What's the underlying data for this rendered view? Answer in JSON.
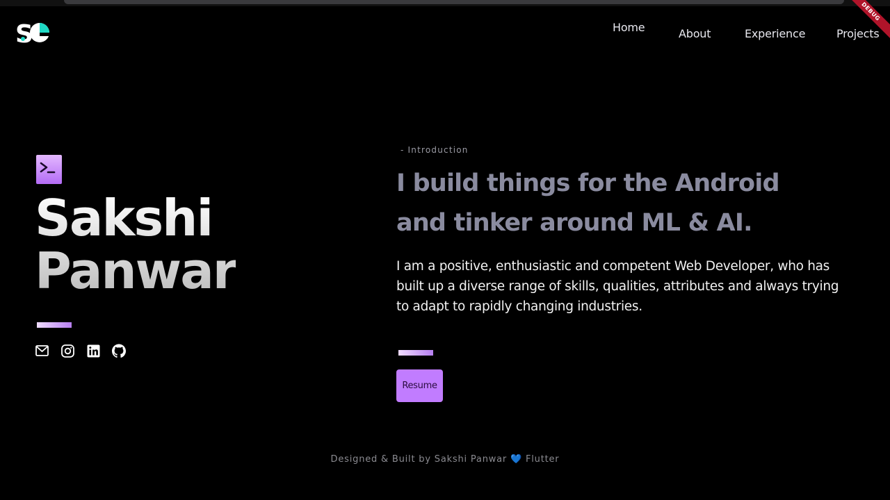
{
  "nav": {
    "home": "Home",
    "about": "About",
    "experience": "Experience",
    "projects": "Projects"
  },
  "debug_banner": "DEBUG",
  "hero": {
    "first_name": "Sakshi",
    "last_name": "Panwar",
    "intro_label": "- Introduction",
    "headline": "I build things for the Android and tinker around ML & AI.",
    "description": "I am a positive, enthusiastic and competent Web Developer, who has built up a diverse range of skills, qualities, attributes and always trying to adapt to rapidly changing industries.",
    "resume_button": "Resume"
  },
  "socials": [
    "mail-icon",
    "instagram-icon",
    "linkedin-icon",
    "github-icon"
  ],
  "footer": {
    "prefix": "Designed & Built by Sakshi Panwar",
    "heart": "💙",
    "suffix": "Flutter"
  },
  "colors": {
    "accent": "#c17cff",
    "headline": "#8a8b9f",
    "logo_teal": "#1fd8c4",
    "background": "#000000"
  }
}
